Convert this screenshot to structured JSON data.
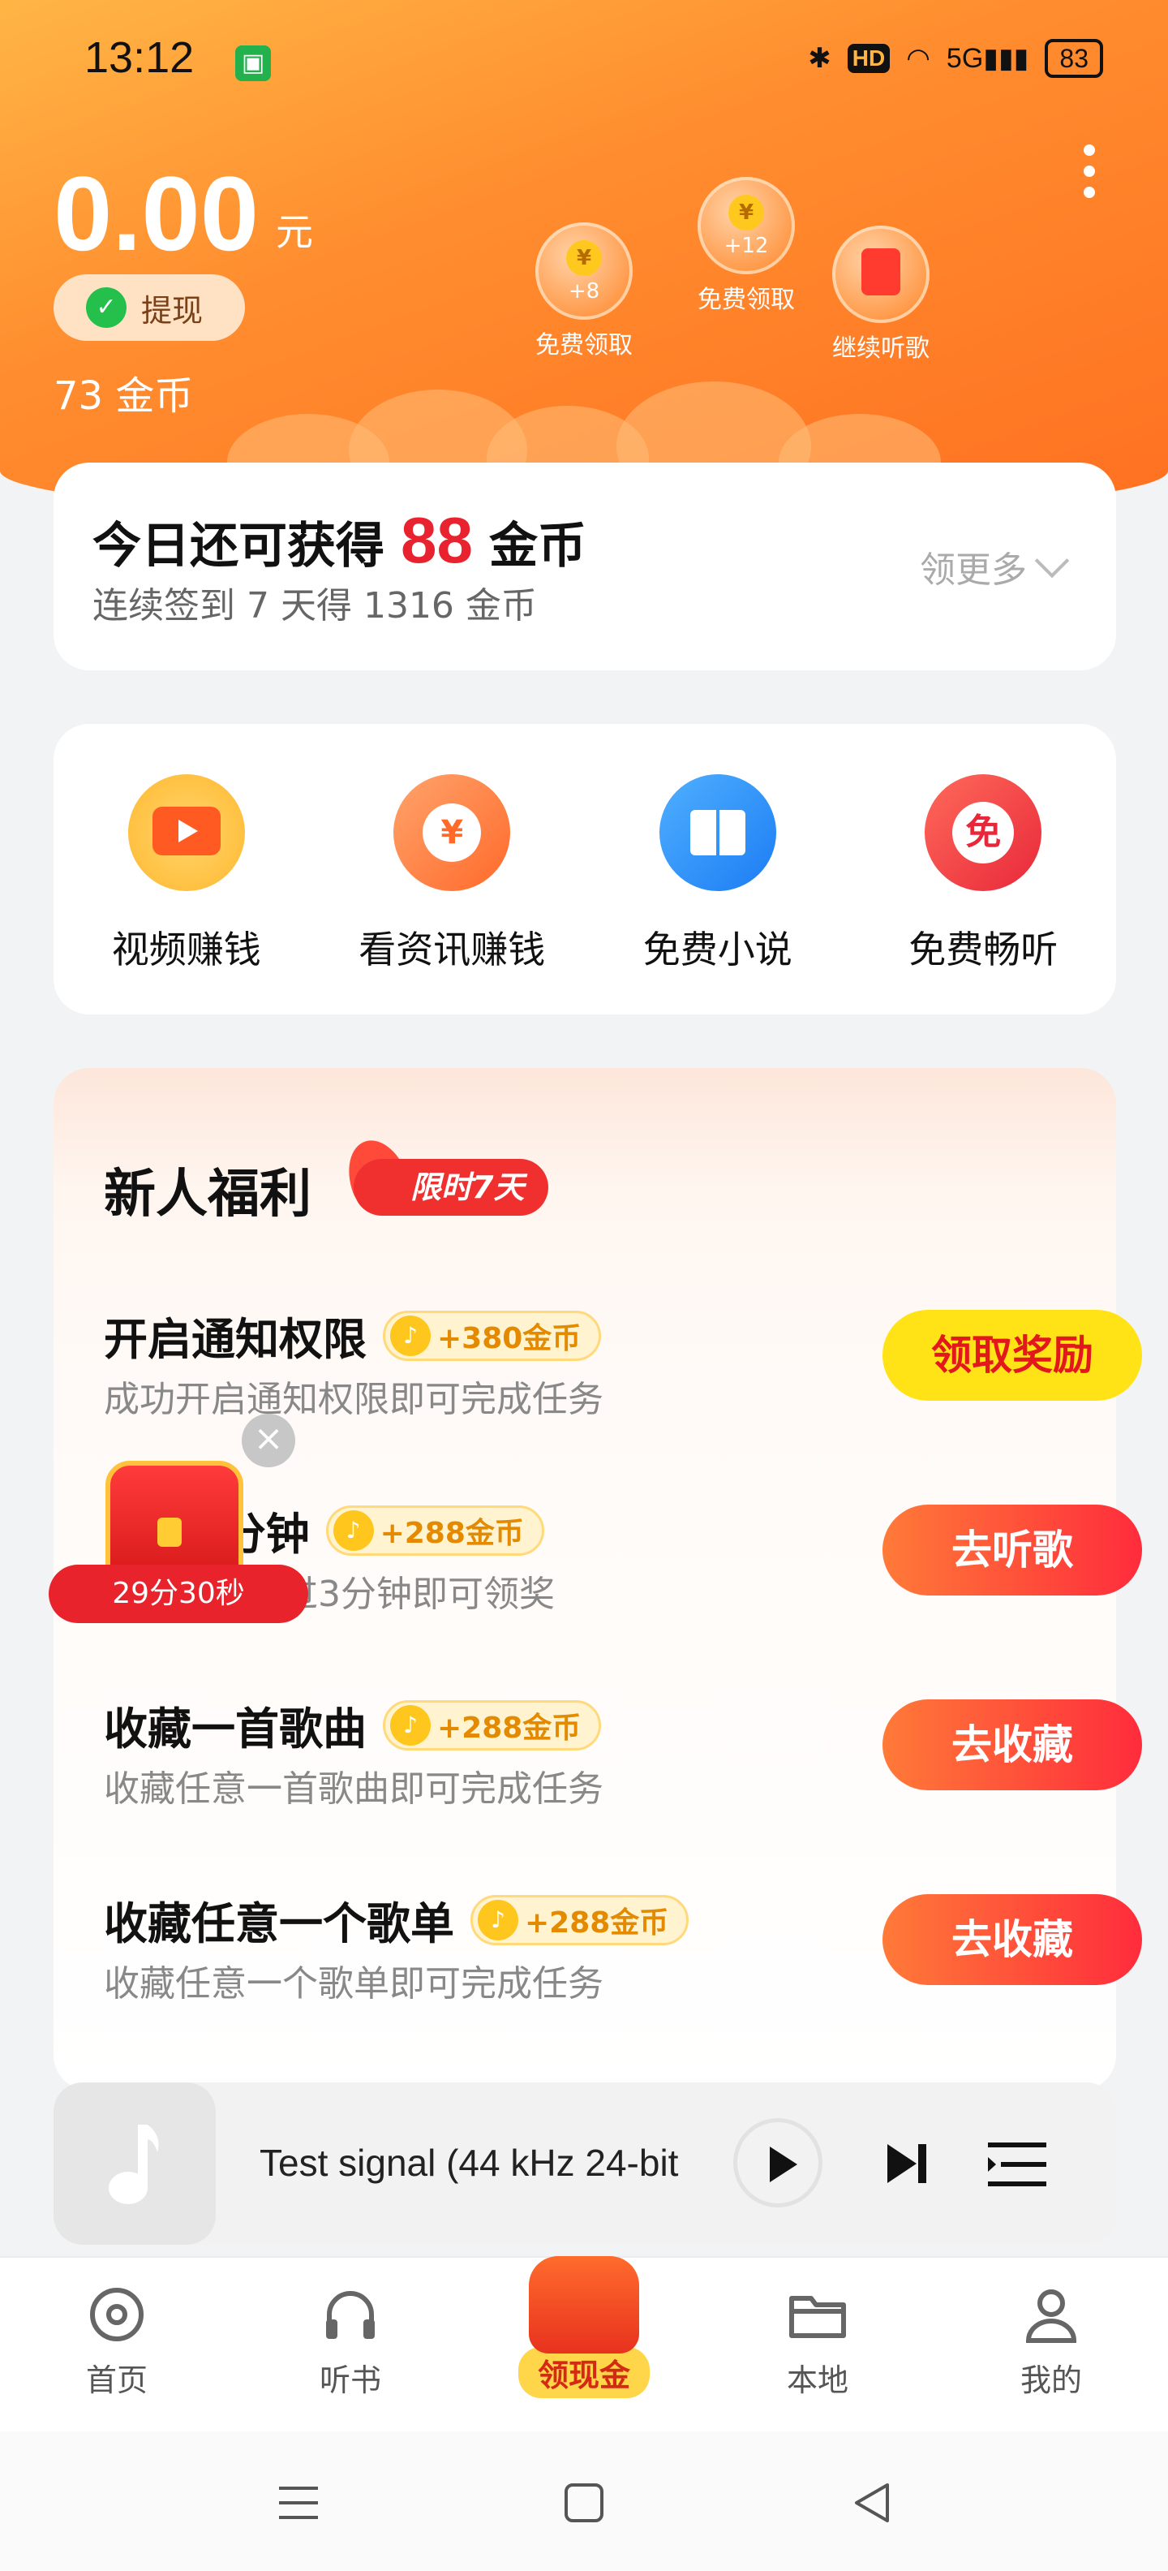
{
  "status_bar": {
    "time": "13:12",
    "network": "5G",
    "battery": "83",
    "hd": "HD"
  },
  "header": {
    "balance": "0.00",
    "balance_unit": "元",
    "withdraw_label": "提现",
    "coins": "73 金币",
    "bubbles": [
      {
        "amount": "+8",
        "label": "免费领取"
      },
      {
        "amount": "+12",
        "label": "免费领取"
      },
      {
        "amount": "",
        "label": "继续听歌"
      }
    ]
  },
  "signin": {
    "prefix": "今日还可获得",
    "amount": "88",
    "suffix": "金币",
    "subtitle": "连续签到 7 天得 1316 金币",
    "more": "领更多"
  },
  "shortcuts": [
    {
      "label": "视频赚钱",
      "icon": "video-tv-icon"
    },
    {
      "label": "看资讯赚钱",
      "icon": "news-planet-icon"
    },
    {
      "label": "免费小说",
      "icon": "book-icon"
    },
    {
      "label": "免费畅听",
      "icon": "free-listen-icon"
    }
  ],
  "newcomer": {
    "title": "新人福利",
    "badge": "限时7天",
    "tasks": [
      {
        "title": "开启通知权限",
        "reward": "+380金币",
        "desc": "成功开启通知权限即可完成任务",
        "button": "领取奖励"
      },
      {
        "title": "听歌3分钟",
        "reward": "+288金币",
        "desc": "听歌时长超过3分钟即可领奖",
        "button": "去听歌"
      },
      {
        "title": "收藏一首歌曲",
        "reward": "+288金币",
        "desc": "收藏任意一首歌曲即可完成任务",
        "button": "去收藏"
      },
      {
        "title": "收藏任意一个歌单",
        "reward": "+288金币",
        "desc": "收藏任意一个歌单即可完成任务",
        "button": "去收藏"
      }
    ]
  },
  "chest": {
    "timer": "29分30秒"
  },
  "player": {
    "title": "Test signal (44 kHz 24-bit"
  },
  "bottom_nav": [
    {
      "label": "首页"
    },
    {
      "label": "听书"
    },
    {
      "label": "领现金"
    },
    {
      "label": "本地"
    },
    {
      "label": "我的"
    }
  ],
  "colors": {
    "brand_orange": "#ff8d2f",
    "accent_red": "#e8222f",
    "button_yellow": "#ffe316"
  }
}
